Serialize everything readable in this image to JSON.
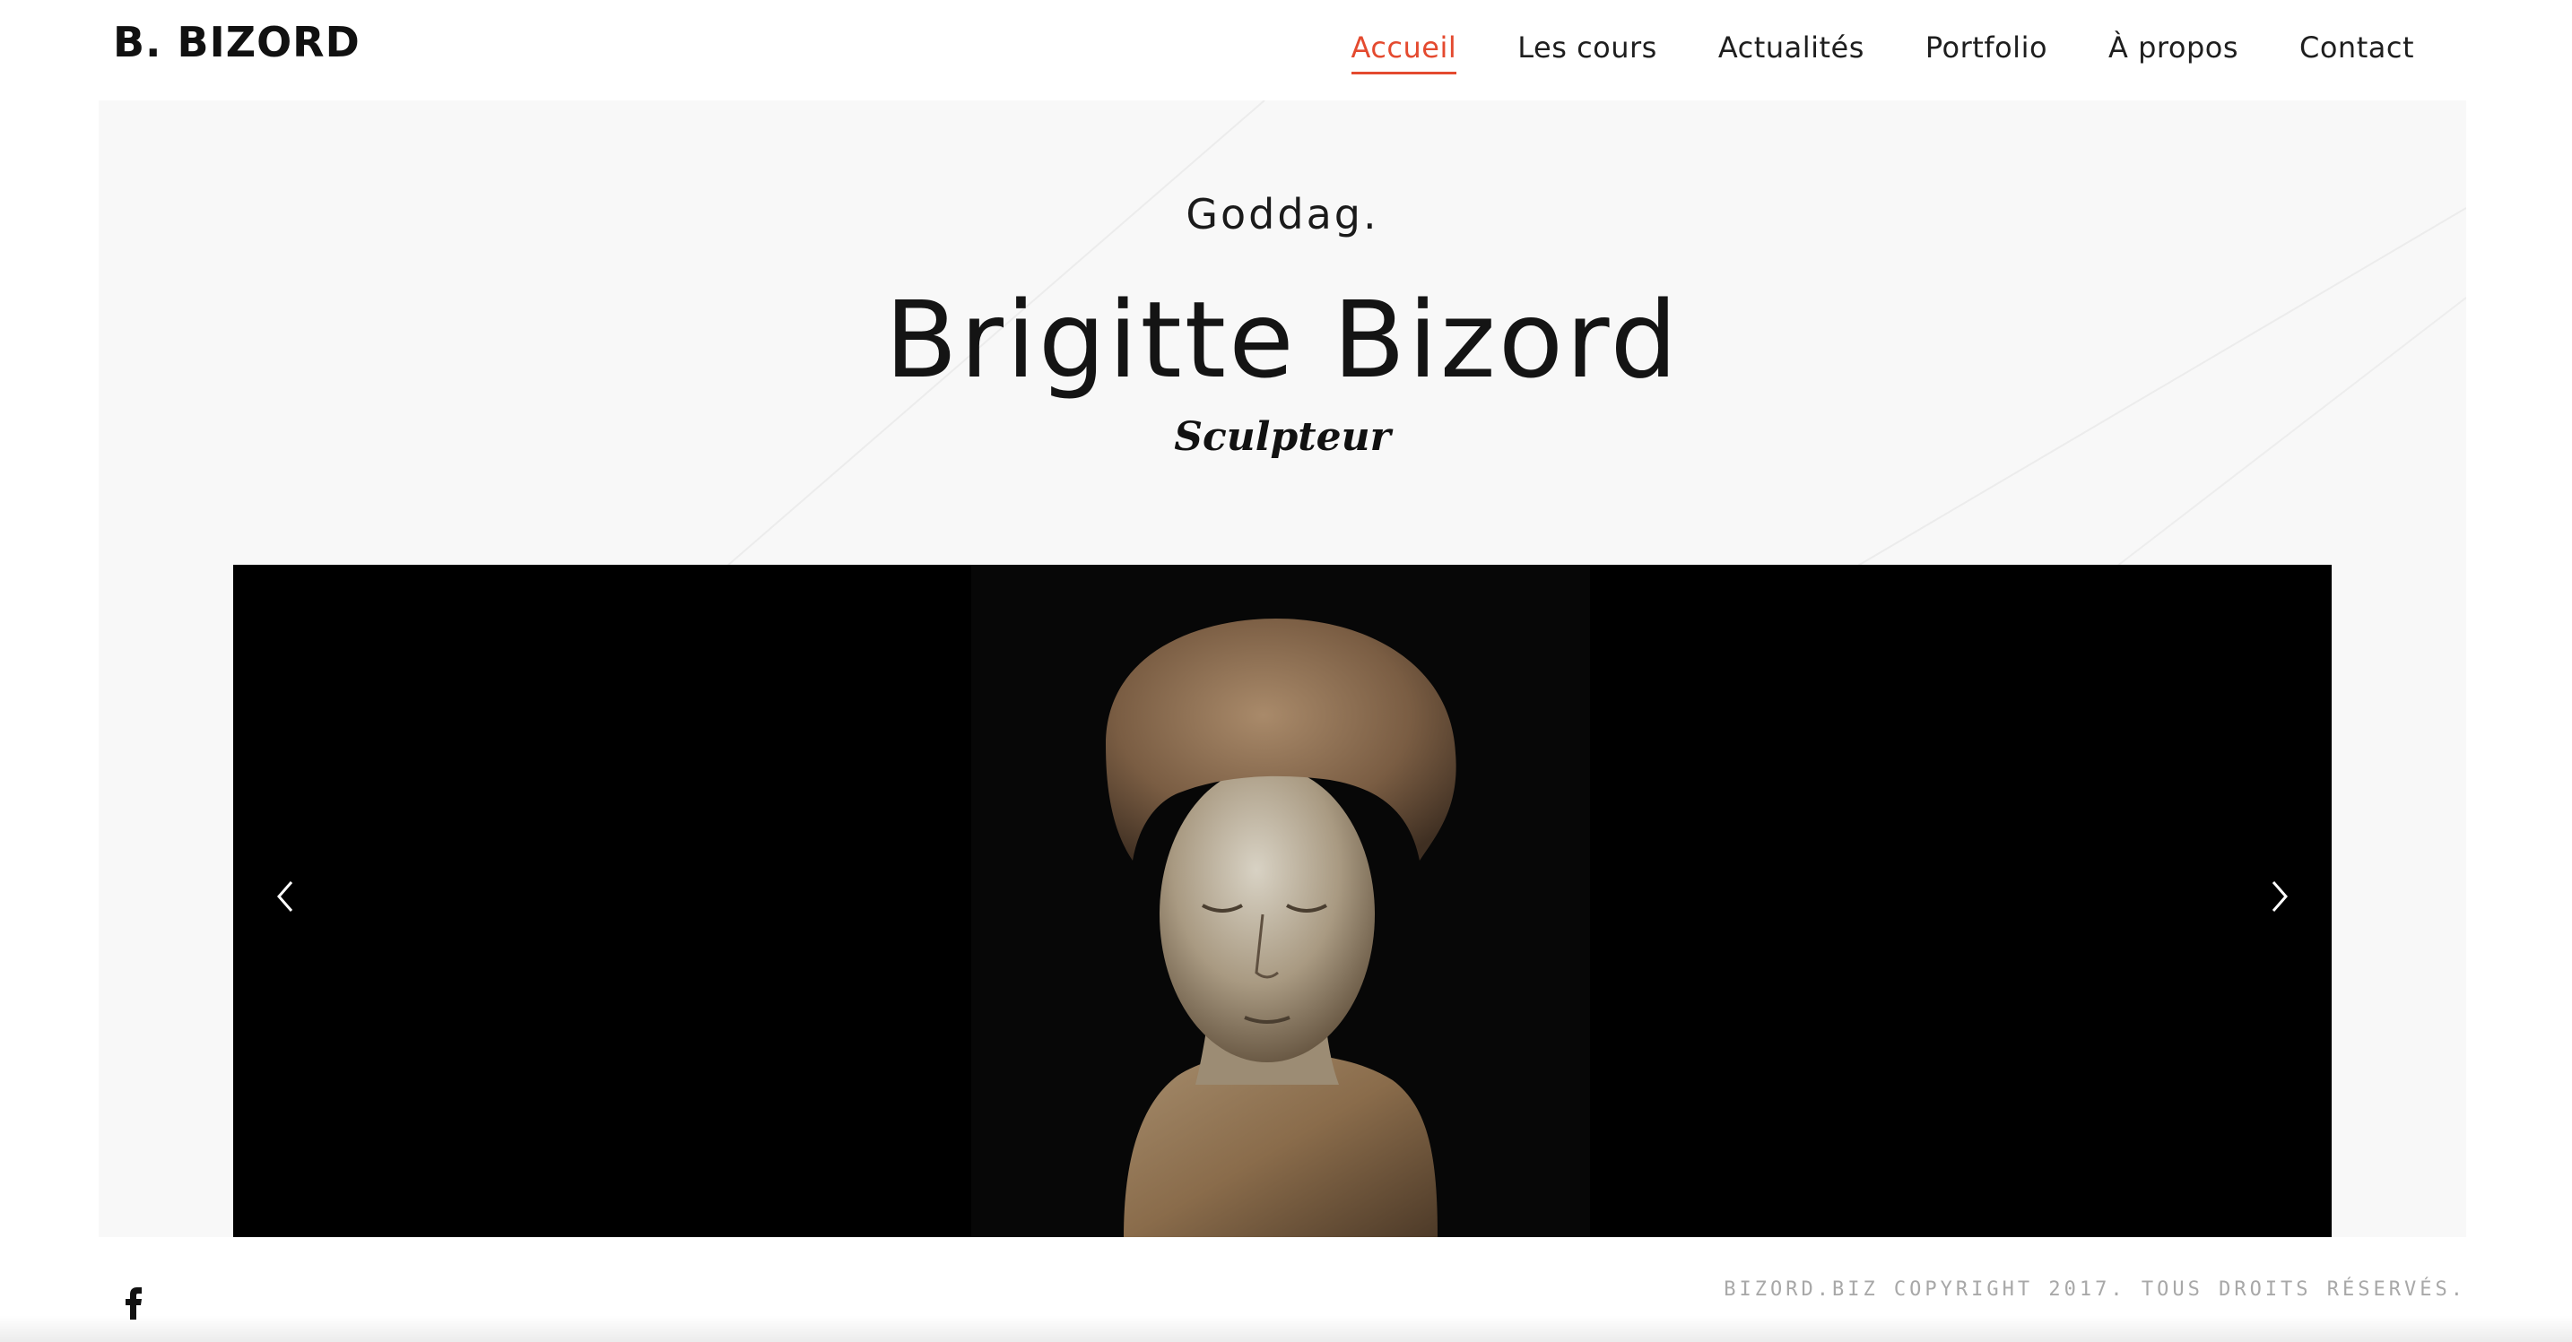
{
  "header": {
    "logo": "B. BIZORD",
    "nav": [
      {
        "label": "Accueil",
        "active": true
      },
      {
        "label": "Les cours",
        "active": false
      },
      {
        "label": "Actualités",
        "active": false
      },
      {
        "label": "Portfolio",
        "active": false
      },
      {
        "label": "À propos",
        "active": false
      },
      {
        "label": "Contact",
        "active": false
      }
    ]
  },
  "hero": {
    "greeting": "Goddag.",
    "name": "Brigitte Bizord",
    "role": "Sculpteur"
  },
  "slider": {
    "prev_icon": "chevron-left-icon",
    "next_icon": "chevron-right-icon",
    "image": "bronze-bust-sculpture"
  },
  "footer": {
    "social_icon": "facebook-icon",
    "copyright": "BIZORD.BIZ COPYRIGHT 2017. TOUS DROITS RÉSERVÉS."
  },
  "colors": {
    "accent": "#e44a2f",
    "hero_bg": "#f8f8f8",
    "slider_bg": "#000000"
  }
}
